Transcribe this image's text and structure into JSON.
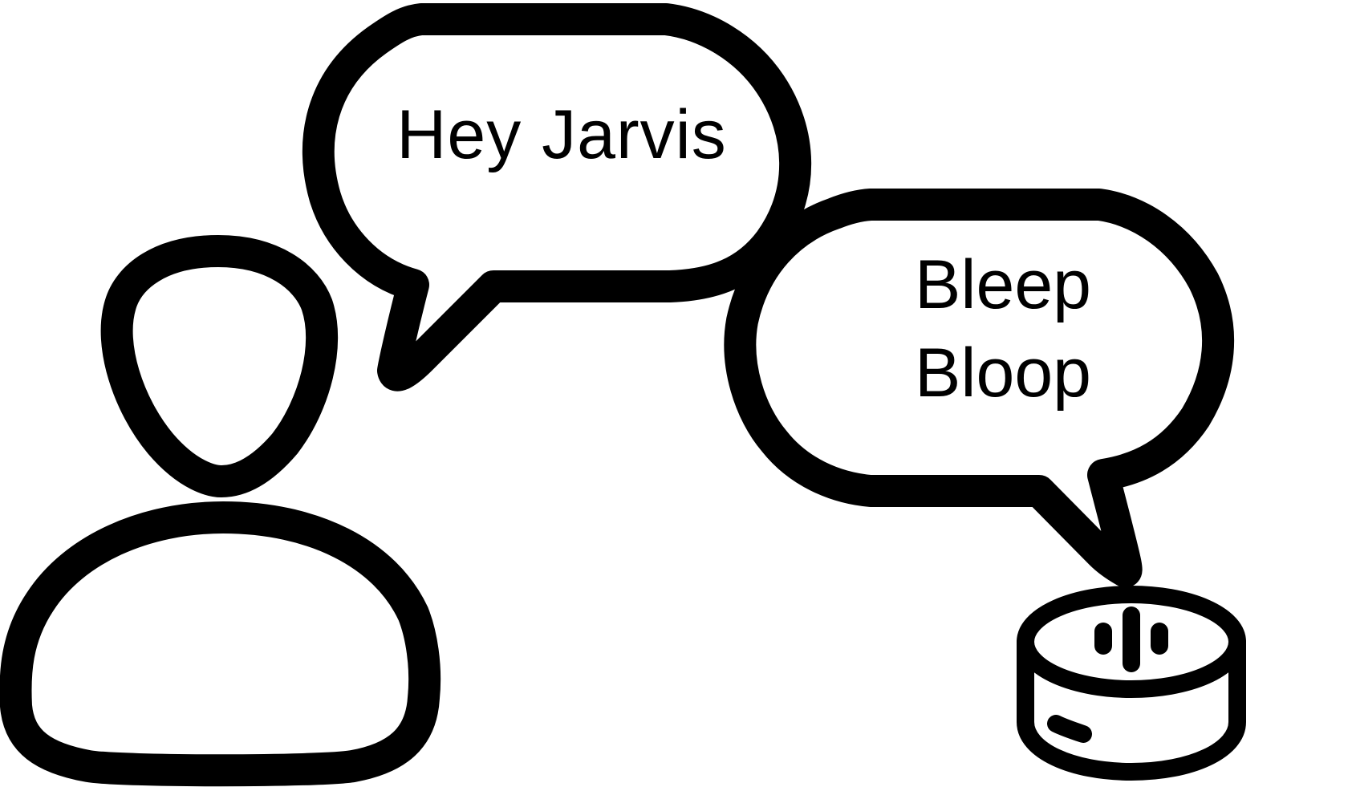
{
  "user_bubble": {
    "text": "Hey Jarvis"
  },
  "speaker_bubble": {
    "line1": "Bleep",
    "line2": "Bloop"
  },
  "icons": {
    "user": "person-icon",
    "speaker": "smart-speaker-icon"
  },
  "colors": {
    "stroke": "#000000",
    "background": "#ffffff"
  }
}
